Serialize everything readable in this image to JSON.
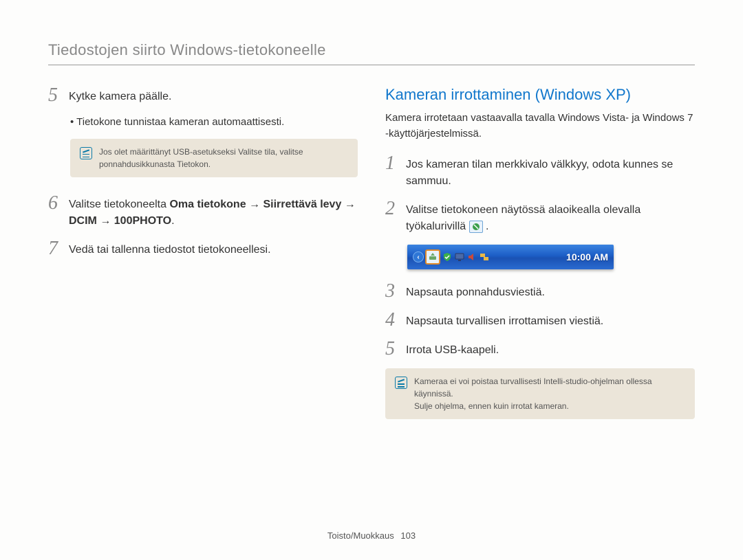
{
  "header": {
    "title": "Tiedostojen siirto Windows-tietokoneelle"
  },
  "left": {
    "step5": {
      "num": "5",
      "text": "Kytke kamera päälle.",
      "bullet_prefix": "•  ",
      "bullet": "Tietokone tunnistaa kameran automaattisesti."
    },
    "note": {
      "prefix": "Jos olet määrittänyt USB-asetukseksi ",
      "bold1": "Valitse tila",
      "mid": ", valitse ponnahdusikkunasta ",
      "bold2": "Tietokon",
      "suffix": "."
    },
    "step6": {
      "num": "6",
      "prefix": "Valitse tietokoneelta ",
      "path": "Oma tietokone → Siirrettävä levy → DCIM → 100PHOTO",
      "suffix": "."
    },
    "step7": {
      "num": "7",
      "text": "Vedä tai tallenna tiedostot tietokoneellesi."
    }
  },
  "right": {
    "title": "Kameran irrottaminen (Windows XP)",
    "sub": "Kamera irrotetaan vastaavalla tavalla Windows Vista- ja Windows 7 -käyttöjärjestelmissä.",
    "step1": {
      "num": "1",
      "text": "Jos kameran tilan merkkivalo välkkyy, odota kunnes se sammuu."
    },
    "step2": {
      "num": "2",
      "prefix": "Valitse tietokoneen näytössä alaoikealla olevalla työkalurivillä ",
      "suffix": " ."
    },
    "taskbar": {
      "icon_main": "safely-remove-icon",
      "icons": [
        "shield-icon",
        "monitor-icon",
        "volume-icon",
        "network-icon"
      ],
      "clock": "10:00 AM"
    },
    "step3": {
      "num": "3",
      "text": "Napsauta ponnahdusviestiä."
    },
    "step4": {
      "num": "4",
      "text": "Napsauta turvallisen irrottamisen viestiä."
    },
    "step5": {
      "num": "5",
      "text": "Irrota USB-kaapeli."
    },
    "note2": {
      "line1": "Kameraa ei voi poistaa turvallisesti Intelli-studio-ohjelman ollessa käynnissä.",
      "line2": "Sulje ohjelma, ennen kuin irrotat kameran."
    }
  },
  "footer": {
    "section": "Toisto/Muokkaus",
    "page": "103"
  }
}
